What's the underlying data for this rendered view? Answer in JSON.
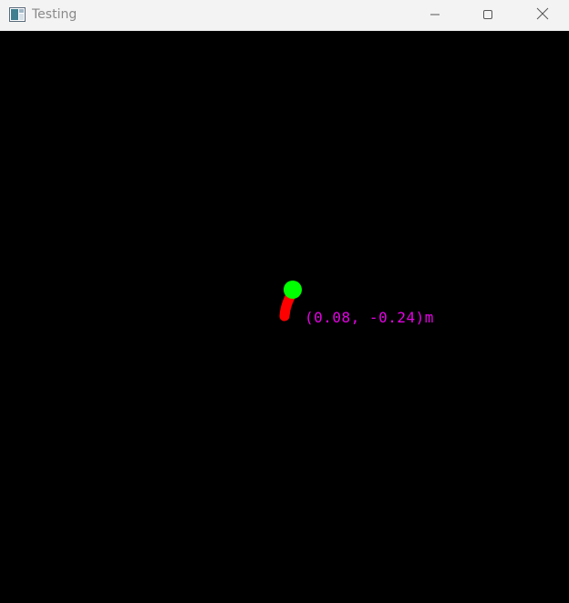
{
  "window": {
    "title": "Testing",
    "icon": "app-window-icon",
    "controls": {
      "minimize_icon": "minimize-icon",
      "maximize_icon": "maximize-icon",
      "close_icon": "close-icon"
    }
  },
  "scene": {
    "background_color": "#000000",
    "trail_color": "#ff0000",
    "marker_color": "#00ff00",
    "position_label": "(0.08, -0.24)m",
    "position_label_color": "#e600e6"
  }
}
